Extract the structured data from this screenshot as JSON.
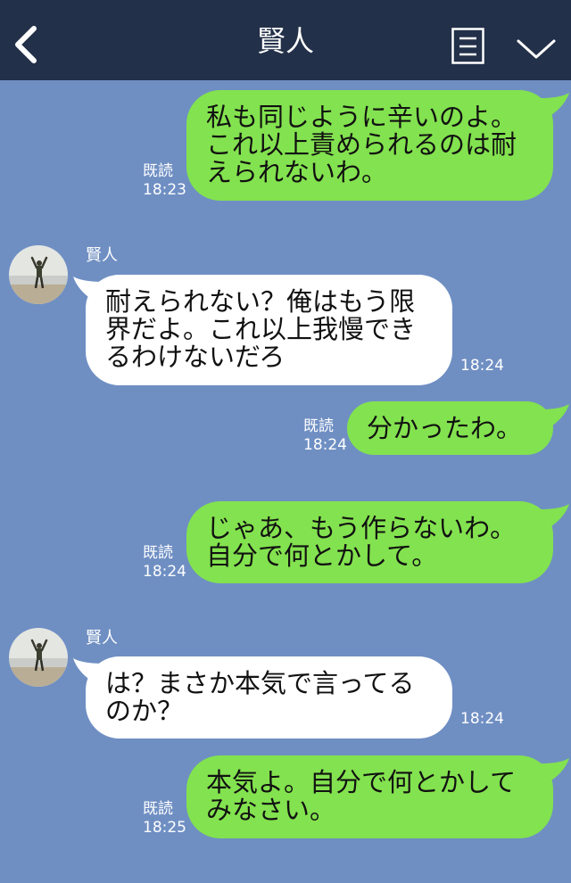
{
  "header": {
    "title": "賢人",
    "back_icon": "back-arrow-icon",
    "menu_icon": "list-icon",
    "dropdown_icon": "chevron-down-icon"
  },
  "messages": [
    {
      "side": "out",
      "text": "私も同じように辛いのよ。これ以上責められるのは耐えられないわ。",
      "read": "既読",
      "time": "18:23"
    },
    {
      "side": "in",
      "sender": "賢人",
      "text": "耐えられない？俺はもう限界だよ。これ以上我慢できるわけないだろ",
      "time": "18:24"
    },
    {
      "side": "out",
      "text": "分かったわ。",
      "read": "既読",
      "time": "18:24"
    },
    {
      "side": "out",
      "text": "じゃあ、もう作らないわ。自分で何とかして。",
      "read": "既読",
      "time": "18:24"
    },
    {
      "side": "in",
      "sender": "賢人",
      "text": "は？まさか本気で言ってるのか？",
      "time": "18:24"
    },
    {
      "side": "out",
      "text": "本気よ。自分で何とかしてみなさい。",
      "read": "既読",
      "time": "18:25"
    }
  ],
  "colors": {
    "background": "#6f8fc3",
    "header": "#233049",
    "outgoing_bubble": "#83e24f",
    "incoming_bubble": "#ffffff"
  }
}
